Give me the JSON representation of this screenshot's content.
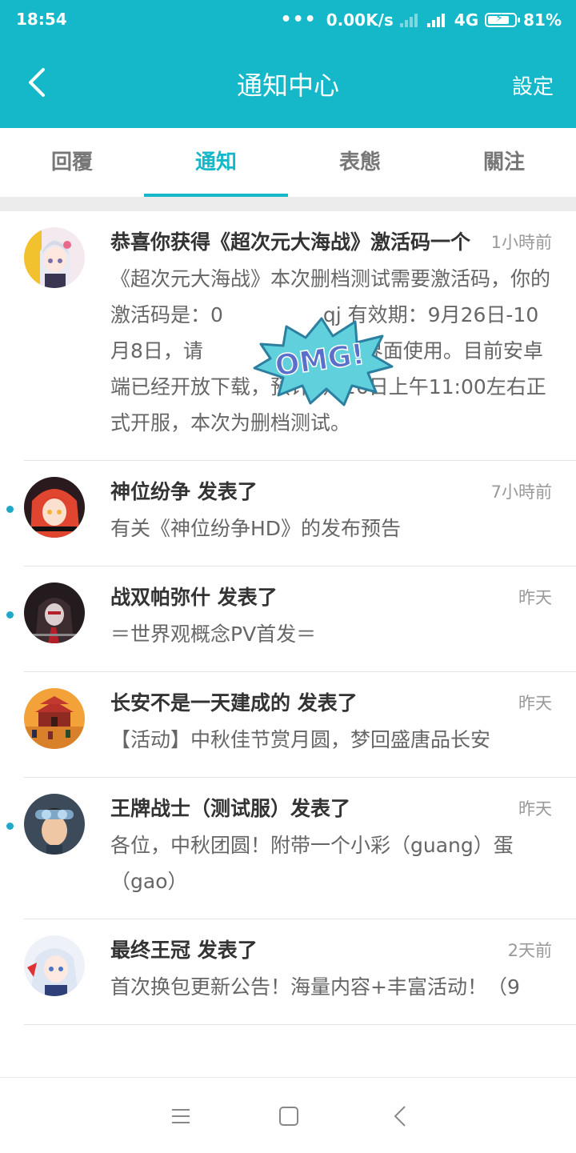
{
  "status_bar": {
    "time": "18:54",
    "network_speed": "0.00K/s",
    "network_type": "4G",
    "battery": "81%",
    "battery_level": 0.81
  },
  "header": {
    "title": "通知中心",
    "settings_label": "設定",
    "back_icon": "chevron-left-icon"
  },
  "tabs": [
    {
      "label": "回覆",
      "active": false
    },
    {
      "label": "通知",
      "active": true
    },
    {
      "label": "表態",
      "active": false
    },
    {
      "label": "關注",
      "active": false
    }
  ],
  "notifications": [
    {
      "title": "恭喜你获得《超次元大海战》激活码一个",
      "time": "1小時前",
      "body": "《超次元大海战》本次删档测试需要激活码，你的激活码是：0　　　　　qj 有效期：9月26日-10月8日，请　　　　内的注册界面使用。目前安卓端已经开放下载，预计9月26日上午11:00左右正式开服，本次为删档测试。",
      "unread": false
    },
    {
      "title": "神位纷争 发表了",
      "time": "7小時前",
      "body": "有关《神位纷争HD》的发布预告",
      "unread": true
    },
    {
      "title": "战双帕弥什 发表了",
      "time": "昨天",
      "body": "＝世界观概念PV首发＝",
      "unread": true
    },
    {
      "title": "长安不是一天建成的 发表了",
      "time": "昨天",
      "body": "【活动】中秋佳节赏月圆，梦回盛唐品长安",
      "unread": false
    },
    {
      "title": "王牌战士（测试服）发表了",
      "time": "昨天",
      "body": "各位，中秋团圆！附带一个小彩（guang）蛋（gao）",
      "unread": true
    },
    {
      "title": "最终王冠 发表了",
      "time": "2天前",
      "body": "首次换包更新公告！海量内容+丰富活动！（9",
      "unread": false
    }
  ],
  "sticker": {
    "text": "OMG!"
  },
  "colors": {
    "accent": "#15b8c8",
    "unread_dot": "#20a8c8"
  }
}
